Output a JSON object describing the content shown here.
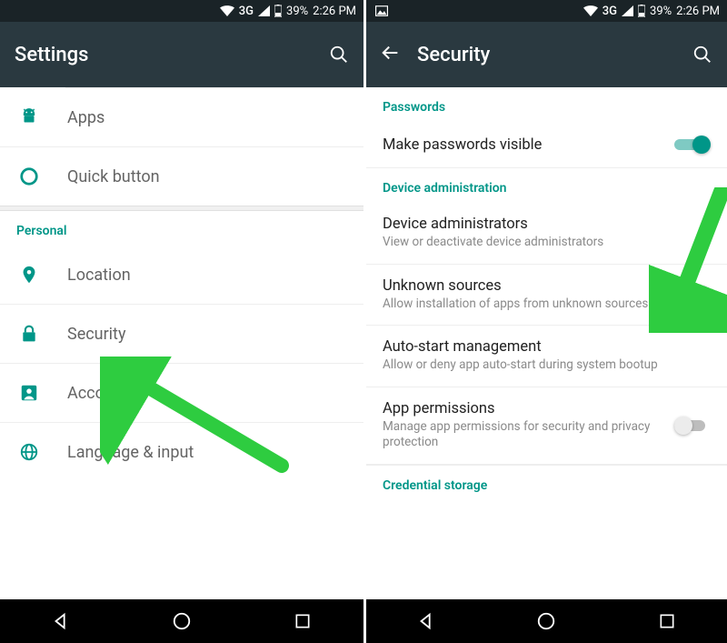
{
  "status": {
    "network": "3G",
    "battery": "39%",
    "time": "2:26 PM"
  },
  "left": {
    "title": "Settings",
    "items_top": [
      {
        "label": "Apps",
        "icon": "android"
      },
      {
        "label": "Quick button",
        "icon": "circle-o"
      }
    ],
    "section_personal": "Personal",
    "items_personal": [
      {
        "label": "Location",
        "icon": "pin"
      },
      {
        "label": "Security",
        "icon": "lock"
      },
      {
        "label": "Accounts",
        "icon": "account"
      },
      {
        "label": "Language & input",
        "icon": "globe"
      }
    ]
  },
  "right": {
    "title": "Security",
    "section_passwords": "Passwords",
    "row_passwords": {
      "title": "Make passwords visible",
      "toggle": "on"
    },
    "section_device_admin": "Device administration",
    "row_device_admin": {
      "title": "Device administrators",
      "sub": "View or deactivate device administrators"
    },
    "row_unknown": {
      "title": "Unknown sources",
      "sub": "Allow installation of apps from unknown sources",
      "toggle": "on"
    },
    "row_autostart": {
      "title": "Auto-start management",
      "sub": "Allow or deny app auto-start during system bootup"
    },
    "row_appperm": {
      "title": "App permissions",
      "sub": "Manage app permissions for security and privacy protection",
      "toggle": "off"
    },
    "section_cred": "Credential storage"
  }
}
